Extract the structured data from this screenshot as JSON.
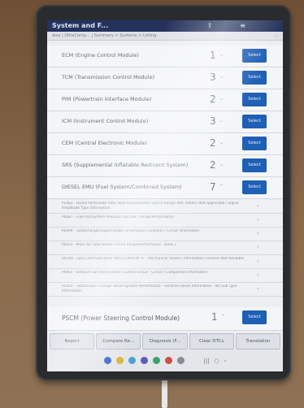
{
  "app": {
    "title": "System and F...",
    "breadcrumb": "Asia | UltraComp... | Summary > Systems > Listing"
  },
  "modules": [
    {
      "name": "ECM (Engine Control Module)",
      "count": "1",
      "button": "Select"
    },
    {
      "name": "TCM (Transmission Control Module)",
      "count": "3",
      "button": "Select"
    },
    {
      "name": "PIM (Powertrain Interface Module)",
      "count": "2",
      "button": "Select"
    },
    {
      "name": "ICM (Instrument Control Module)",
      "count": "3",
      "button": "Select"
    },
    {
      "name": "CEM (Central Electronic Module)",
      "count": "2",
      "button": "Select"
    },
    {
      "name": "SRS (Supplemental Inflatable Restraint System)",
      "count": "2",
      "button": "Select"
    },
    {
      "name": "DIESEL EMU (Fuel System/Combined System)",
      "count": "7",
      "button": "Select"
    }
  ],
  "dtcs": [
    "P2463 - Diesel Particulate Filter Soot Accumulation Out Of Range; Not Tested / Not Applicable / Signal Amplitude Type Information",
    "P0087 - Fuel Rail/System Pressure Too Low / Range/Performance",
    "P0299 - Turbocharger/Supercharger Underboost Condition / Circuit Information",
    "P0101 - Mass Air Flow Sensor Circuit Range/Performance - Bank 1",
    "U0100 - Lost Communication With ECM/PCM 'A' - Mechanical Failure / Information Function Not Available",
    "P0403 - Exhaust Gas Recirculation Control Circuit - Circuit / Component Information",
    "P2263 - Turbo/Super Charger Boost System Performance - General Failure Information - No Sub Type Information"
  ],
  "psm": {
    "name": "PSCM (Power Steering Control Module)",
    "count": "1",
    "button": "Select"
  },
  "toolbar": {
    "report": "Report",
    "compare": "Compare Re...",
    "diagnosis": "Diagnosis (F...",
    "clear": "Clear DTCs",
    "translation": "Translation"
  }
}
